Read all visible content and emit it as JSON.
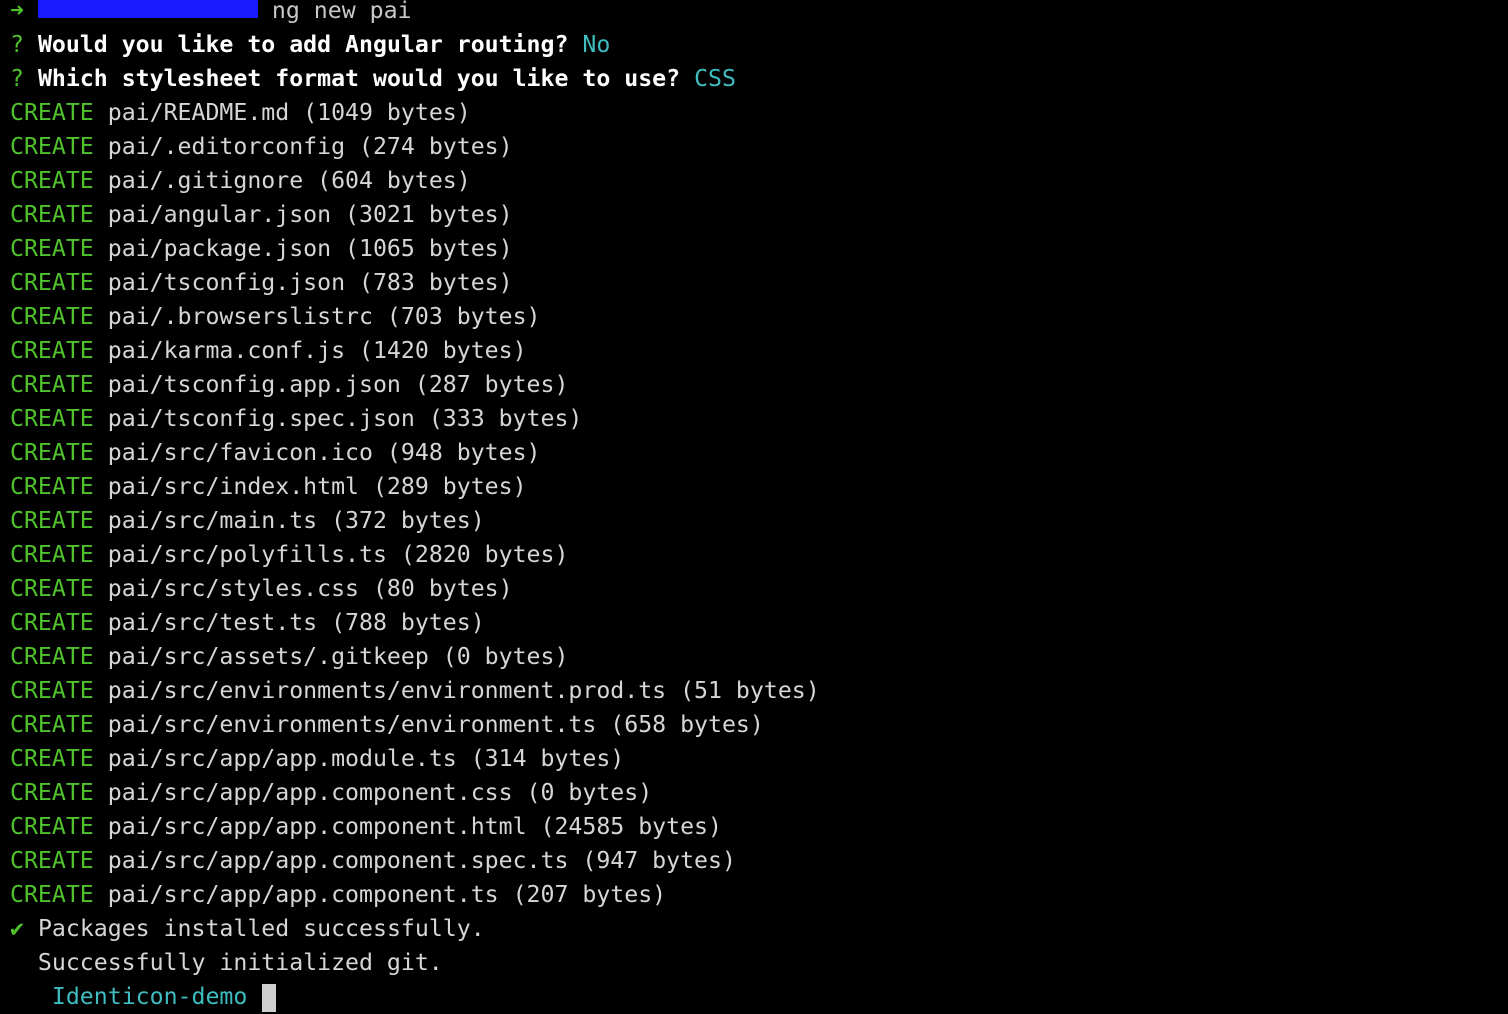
{
  "colors": {
    "background": "#000000",
    "create": "#4fc22c",
    "answer": "#3fbcbf",
    "prompt_arrow": "#4fc22c",
    "redaction": "#1a1aff"
  },
  "prompt": {
    "arrow": "➜",
    "command": "ng new pai"
  },
  "questions": [
    {
      "mark": "?",
      "text": "Would you like to add Angular routing?",
      "answer": "No"
    },
    {
      "mark": "?",
      "text": "Which stylesheet format would you like to use?",
      "answer": "CSS"
    }
  ],
  "create_label": "CREATE",
  "files": [
    "pai/README.md (1049 bytes)",
    "pai/.editorconfig (274 bytes)",
    "pai/.gitignore (604 bytes)",
    "pai/angular.json (3021 bytes)",
    "pai/package.json (1065 bytes)",
    "pai/tsconfig.json (783 bytes)",
    "pai/.browserslistrc (703 bytes)",
    "pai/karma.conf.js (1420 bytes)",
    "pai/tsconfig.app.json (287 bytes)",
    "pai/tsconfig.spec.json (333 bytes)",
    "pai/src/favicon.ico (948 bytes)",
    "pai/src/index.html (289 bytes)",
    "pai/src/main.ts (372 bytes)",
    "pai/src/polyfills.ts (2820 bytes)",
    "pai/src/styles.css (80 bytes)",
    "pai/src/test.ts (788 bytes)",
    "pai/src/assets/.gitkeep (0 bytes)",
    "pai/src/environments/environment.prod.ts (51 bytes)",
    "pai/src/environments/environment.ts (658 bytes)",
    "pai/src/app/app.module.ts (314 bytes)",
    "pai/src/app/app.component.css (0 bytes)",
    "pai/src/app/app.component.html (24585 bytes)",
    "pai/src/app/app.component.spec.ts (947 bytes)",
    "pai/src/app/app.component.ts (207 bytes)"
  ],
  "success": {
    "mark": "✔",
    "text": "Packages installed successfully."
  },
  "git": "  Successfully initialized git.",
  "next_prompt": {
    "dir": "Identicon-demo"
  }
}
